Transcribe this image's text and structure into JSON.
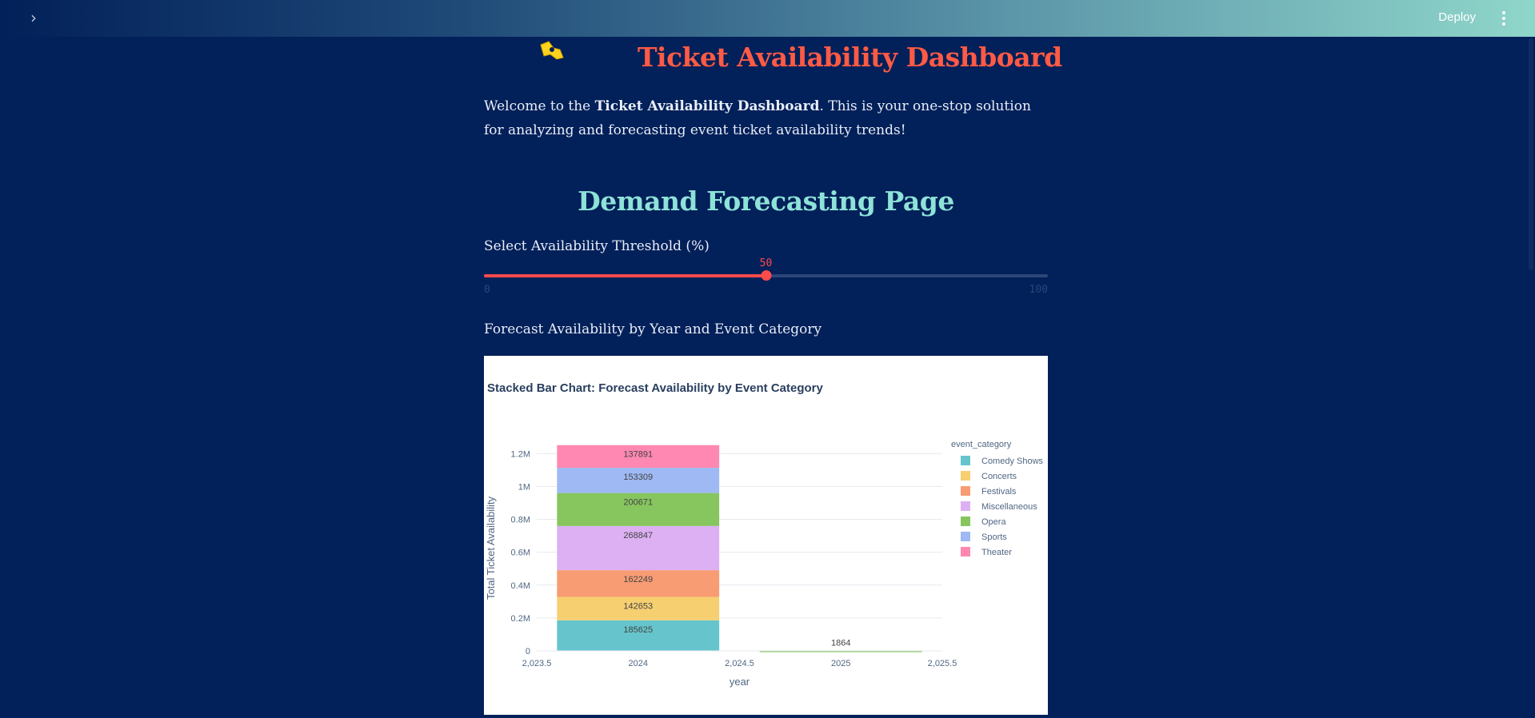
{
  "topbar": {
    "deploy_label": "Deploy"
  },
  "header": {
    "title": "Ticket Availability Dashboard",
    "intro_prefix": "Welcome to the ",
    "intro_bold": "Ticket Availability Dashboard",
    "intro_suffix": ". This is your one-stop solution for analyzing and forecasting event ticket availability trends!"
  },
  "page": {
    "section_title": "Demand Forecasting Page"
  },
  "slider": {
    "label": "Select Availability Threshold (%)",
    "value": 50,
    "min": 0,
    "max": 100,
    "min_label": "0",
    "max_label": "100"
  },
  "chart_section": {
    "heading": "Forecast Availability by Year and Event Category"
  },
  "chart_data": {
    "type": "bar",
    "stacked": true,
    "title": "Stacked Bar Chart: Forecast Availability by Event Category",
    "xlabel": "year",
    "ylabel": "Total Ticket Availability",
    "x": [
      2024,
      2025
    ],
    "xlim": [
      2023.5,
      2025.5
    ],
    "ylim": [
      0,
      1250000.0
    ],
    "x_ticks": [
      {
        "value": 2023.5,
        "label": "2,023.5"
      },
      {
        "value": 2024,
        "label": "2024"
      },
      {
        "value": 2024.5,
        "label": "2,024.5"
      },
      {
        "value": 2025,
        "label": "2025"
      },
      {
        "value": 2025.5,
        "label": "2,025.5"
      }
    ],
    "y_ticks": [
      {
        "value": 0,
        "label": "0"
      },
      {
        "value": 200000,
        "label": "0.2M"
      },
      {
        "value": 400000,
        "label": "0.4M"
      },
      {
        "value": 600000,
        "label": "0.6M"
      },
      {
        "value": 800000,
        "label": "0.8M"
      },
      {
        "value": 1000000,
        "label": "1M"
      },
      {
        "value": 1200000,
        "label": "1.2M"
      }
    ],
    "legend_title": "event_category",
    "legend_position": "right",
    "grid": true,
    "series": [
      {
        "name": "Comedy Shows",
        "color": "#66c5cc",
        "values": [
          185625,
          null
        ]
      },
      {
        "name": "Concerts",
        "color": "#f6cf71",
        "values": [
          142653,
          null
        ]
      },
      {
        "name": "Festivals",
        "color": "#f89c74",
        "values": [
          162249,
          null
        ]
      },
      {
        "name": "Miscellaneous",
        "color": "#dcb0f2",
        "values": [
          268847,
          null
        ]
      },
      {
        "name": "Opera",
        "color": "#87c55f",
        "values": [
          200671,
          1864
        ]
      },
      {
        "name": "Sports",
        "color": "#9eb9f3",
        "values": [
          153309,
          null
        ]
      },
      {
        "name": "Theater",
        "color": "#fe88b1",
        "values": [
          137891,
          null
        ]
      }
    ]
  }
}
